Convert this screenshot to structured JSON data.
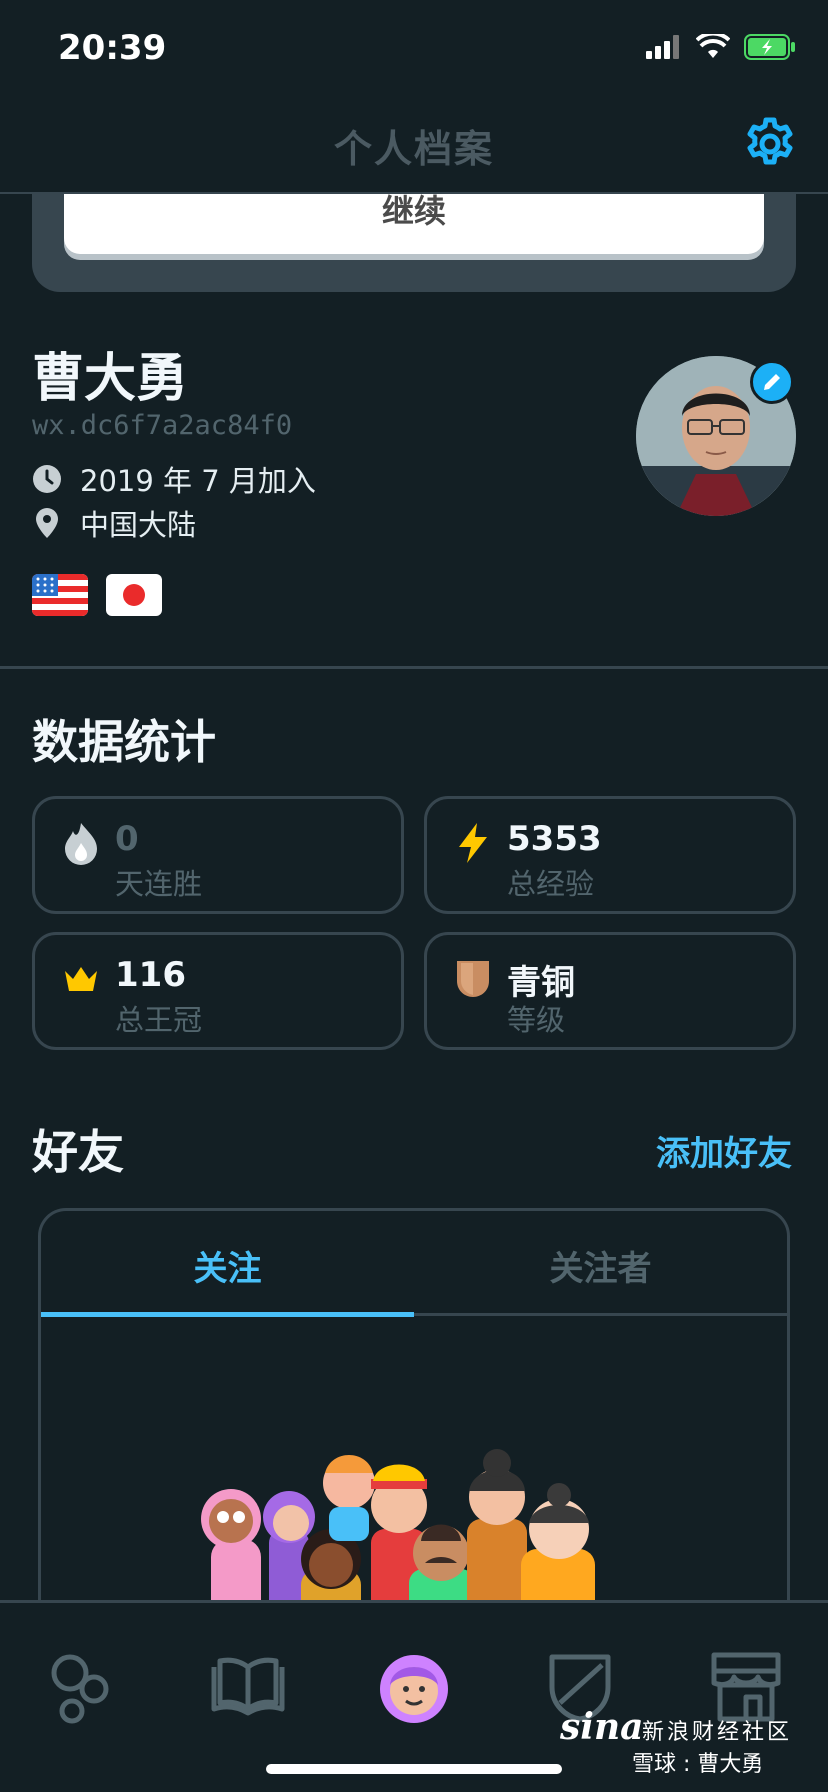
{
  "status_bar": {
    "time": "20:39"
  },
  "header": {
    "title": "个人档案"
  },
  "continue_button": {
    "label": "继续"
  },
  "profile": {
    "name": "曹大勇",
    "username": "wx.dc6f7a2ac84f0",
    "joined": "2019 年 7 月加入",
    "location": "中国大陆",
    "flags": [
      "us-flag",
      "japan-flag"
    ]
  },
  "stats": {
    "title": "数据统计",
    "cards": [
      {
        "value": "0",
        "label": "天连胜",
        "icon": "fire-icon"
      },
      {
        "value": "5353",
        "label": "总经验",
        "icon": "lightning-icon"
      },
      {
        "value": "116",
        "label": "总王冠",
        "icon": "crown-icon"
      },
      {
        "value": "青铜",
        "label": "等级",
        "icon": "bronze-shield-icon"
      }
    ]
  },
  "friends": {
    "title": "好友",
    "add_label": "添加好友",
    "tabs": [
      "关注",
      "关注者"
    ]
  },
  "nav": [
    "learn-icon",
    "stories-icon",
    "profile-icon",
    "leagues-icon",
    "shop-icon"
  ],
  "watermark": {
    "logo": "sina",
    "line1": "新浪财经社区",
    "line2": "雪球 : 曹大勇"
  },
  "colors": {
    "background": "#131f24",
    "accent": "#49c0f8",
    "border": "#37464f",
    "muted": "#52656d",
    "gold": "#ffc800"
  }
}
